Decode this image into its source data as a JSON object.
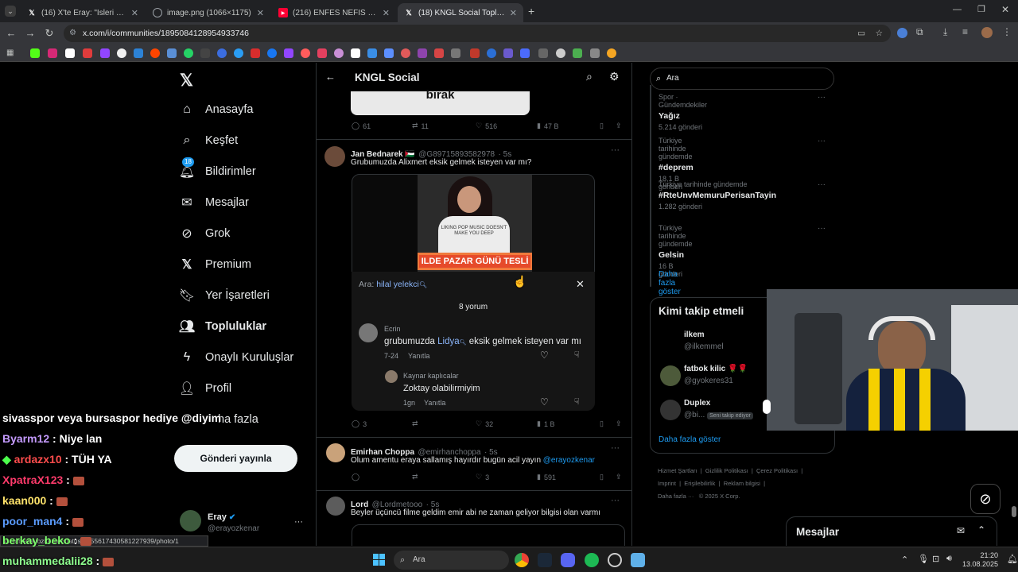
{
  "browser": {
    "tabs": [
      {
        "title": "(16) X'te Eray: \"Isleri bekliyorum\"",
        "favicon": "x-icon"
      },
      {
        "title": "image.png (1066×1175)",
        "favicon": "globe-icon"
      },
      {
        "title": "(216) ENFES NEFİS PİZZALARIM",
        "favicon": "youtube-icon"
      },
      {
        "title": "(18) KNGL Social Topluluk / X",
        "favicon": "x-icon"
      }
    ],
    "url": "x.com/i/communities/1895084128954933746",
    "status_url": "x.com/erayozkenar/status/1955617430581227939/photo/1"
  },
  "sidebar": {
    "items": [
      {
        "label": "Anasayfa",
        "icon": "home-icon"
      },
      {
        "label": "Keşfet",
        "icon": "search-icon"
      },
      {
        "label": "Bildirimler",
        "icon": "bell-icon",
        "badge": "18"
      },
      {
        "label": "Mesajlar",
        "icon": "mail-icon"
      },
      {
        "label": "Grok",
        "icon": "grok-icon"
      },
      {
        "label": "Premium",
        "icon": "x-icon"
      },
      {
        "label": "Yer İşaretleri",
        "icon": "bookmark-icon"
      },
      {
        "label": "Topluluklar",
        "icon": "people-icon"
      },
      {
        "label": "Onaylı Kuruluşlar",
        "icon": "bolt-icon"
      },
      {
        "label": "Profil",
        "icon": "person-icon"
      }
    ],
    "more_label": "ha fazla",
    "post_button": "Gönderi yayınla",
    "account": {
      "name": "Eray",
      "handle": "@erayozkenar",
      "more": "···"
    }
  },
  "header": {
    "title": "KNGL Social"
  },
  "posts": [
    {
      "media_text": "bırak",
      "replies": "61",
      "reposts": "11",
      "likes": "516",
      "views": "47 B"
    },
    {
      "author": "Jan Bednarek 🇵🇸",
      "handle": "@G89715893582978",
      "time": "· 5s",
      "text": "Grubumuzda Alixmert eksik gelmek isteyen var mı?",
      "banner_text": "ILDE PAZAR GÜNÜ TESLİ",
      "shirt_text": "LIKING POP MUSIC DOESN'T MAKE YOU DEEP",
      "replies": "3",
      "reposts": "",
      "likes": "32",
      "views": "1 B"
    },
    {
      "author": "Emirhan Choppa",
      "handle": "@emirhanchoppa",
      "time": "· 5s",
      "text": "Olum amentu eraya sallamış hayırdır bugün acil yayın",
      "mention": "@erayozkenar",
      "replies": "",
      "reposts": "",
      "likes": "3",
      "views": "591"
    },
    {
      "author": "Lord",
      "handle": "@Lordmetooo",
      "time": "· 5s",
      "text": "Beyler üçüncü filme geldim emir abi ne zaman geliyor bilgisi olan varmı"
    }
  ],
  "overlay": {
    "search_prefix": "Ara:",
    "search_term": "hilal yelekci",
    "count": "8 yorum",
    "comments": [
      {
        "author": "Ecrin",
        "text_before": "grubumuzda",
        "highlight": "Lidya",
        "text_after": "eksik gelmek isteyen var mı",
        "time": "7-24",
        "reply": "Yanıtla"
      },
      {
        "author": "Kaynar kaplıcalar",
        "text": "Zoktay olabilirmiyim",
        "time": "1gn",
        "reply": "Yanıtla"
      }
    ]
  },
  "right": {
    "search_placeholder": "Ara",
    "trends": [
      {
        "context": "Spor · Gündemdekiler",
        "title": "Yağız",
        "count": "5.214 gönderi"
      },
      {
        "context": "Türkiye tarihinde gündemde",
        "title": "#deprem",
        "count": "18,1 B gönderi"
      },
      {
        "context": "Türkiye tarihinde gündemde",
        "title": "#RteUnvMemuruPerisanTayin",
        "count": "1.282 gönderi"
      },
      {
        "context": "Türkiye tarihinde gündemde",
        "title": "Gelsin",
        "count": "16 B gönderi"
      }
    ],
    "trends_more": "Daha fazla göster",
    "who_title": "Kimi takip etmeli",
    "who": [
      {
        "name": "ilkem",
        "handle": "@ilkemmel"
      },
      {
        "name": "fatbok kilic 🌹🌹",
        "handle": "@gyokeres31"
      },
      {
        "name": "Duplex",
        "handle": "@bi...",
        "badge": "Seni takip ediyor"
      }
    ],
    "who_more": "Daha fazla göster",
    "footer": [
      "Hizmet Şartları",
      "Gizlilik Politikası",
      "Çerez Politikası",
      "Imprint",
      "Erişilebilirlik",
      "Reklam bilgisi",
      "Daha fazla ···",
      "© 2025 X Corp."
    ],
    "messages": "Mesajlar"
  },
  "chat": [
    {
      "user": "sivasspor veya bursaspor hediye @diyim",
      "msg": "",
      "color": "#ffffff"
    },
    {
      "user": "Byarm12",
      "msg": " : Niye lan",
      "color": "#c59bff"
    },
    {
      "user": "ardazx10",
      "msg": " : TÜH YA",
      "color": "#ff4d4d"
    },
    {
      "user": "XpatraX123",
      "msg": " : ",
      "color": "#ff3b6b"
    },
    {
      "user": "kaan000",
      "msg": " : ",
      "color": "#ffe36b"
    },
    {
      "user": "poor_man4",
      "msg": " : ",
      "color": "#5b9cff"
    },
    {
      "user": "berkay_beko",
      "msg": " : ",
      "color": "#7dff6b"
    },
    {
      "user": "muhammedalii28",
      "msg": " : ",
      "color": "#8fff8f"
    }
  ],
  "taskbar": {
    "search": "Ara",
    "time": "21:20",
    "date": "13.08.2025"
  },
  "colors": {
    "accent": "#1d9bf0",
    "bg": "#000000",
    "muted": "#71767b"
  }
}
